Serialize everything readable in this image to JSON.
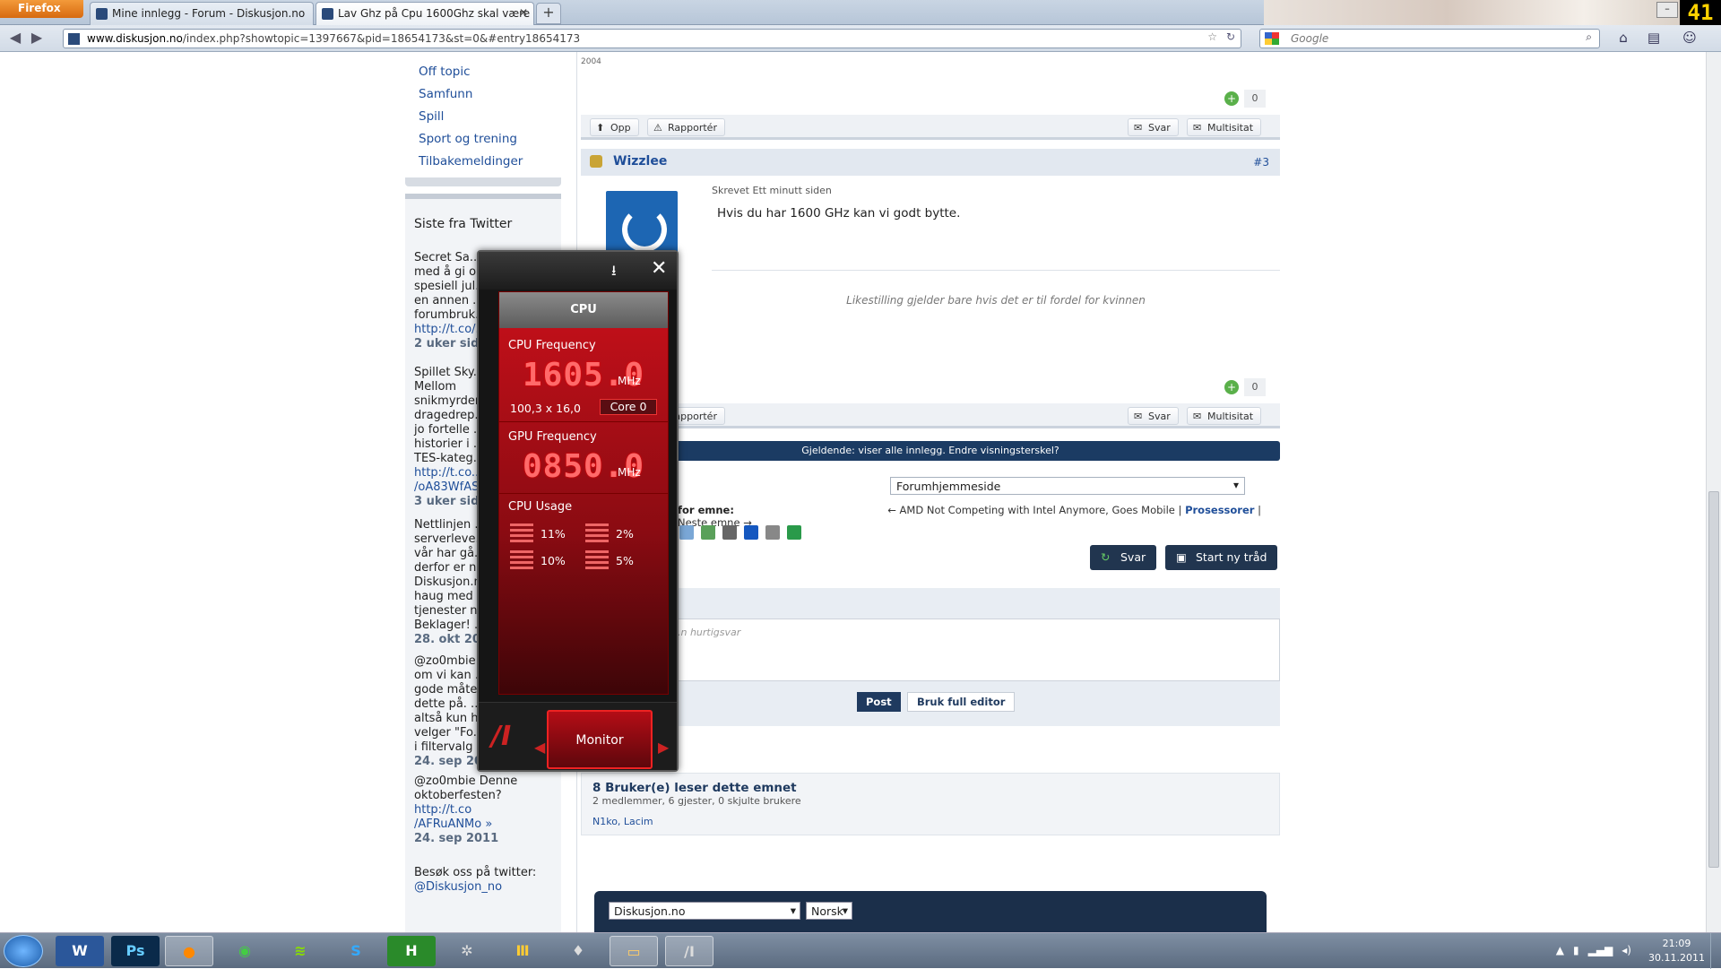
{
  "browser": {
    "firefox_label": "Firefox",
    "tabs": [
      {
        "title": "Mine innlegg - Forum - Diskusjon.no"
      },
      {
        "title": "Lav Ghz på Cpu 1600Ghz skal være 3,..."
      }
    ],
    "new_tab": "+",
    "url_host": "www.diskusjon.no",
    "url_path": "/index.php?showtopic=1397667&pid=18654173&st=0&#entry18654173",
    "search_placeholder": "Google",
    "clock_badge": "41"
  },
  "sidebar": {
    "categories": [
      "Off topic",
      "Samfunn",
      "Spill",
      "Sport og trening",
      "Tilbakemeldinger"
    ],
    "twitter_title": "Siste fra Twitter",
    "tweets": [
      {
        "lines": [
          "Secret Sa...",
          "med å gi o...",
          "spesiell jul...",
          "en annen ...",
          "forumbruk..."
        ],
        "link": "http://t.co/...",
        "date": "2 uker sid..."
      },
      {
        "lines": [
          "Spillet Sky...",
          "Mellom",
          "snikmyrder...",
          "dragedrep...",
          "jo fortelle ...",
          "historier i ...",
          "TES-kateg..."
        ],
        "link": "http://t.co...",
        "link2": "/oA83WfAS...",
        "date": "3 uker sid..."
      },
      {
        "lines": [
          "Nettlinjen ...",
          "serverleve...",
          "vår har gå...",
          "derfor er n...",
          "Diskusjon.n...",
          "haug med ...",
          "tjenester n...",
          "Beklager! ..."
        ],
        "date": "28. okt 20..."
      },
      {
        "lines": [
          "@zo0mbie ...",
          "om vi kan ...",
          "gode måte...",
          "dette på. ...",
          "altså kun h...",
          "velger \"Fo...",
          "i filtervalg \"s2k\"! »"
        ],
        "date": "24. sep 2011"
      },
      {
        "lines": [
          "@zo0mbie Denne",
          "oktoberfesten?"
        ],
        "link": "http://t.co",
        "link2": "/AFRuANMo »",
        "date": "24. sep 2011"
      }
    ],
    "footer_text": "Besøk oss på twitter:",
    "footer_handle": "@Diskusjon_no"
  },
  "post_prev": {
    "year_fragment": "2004",
    "rep_count": "0",
    "btn_up": "Opp",
    "btn_report": "Rapportér",
    "btn_reply": "Svar",
    "btn_multiquote": "Multisitat"
  },
  "post3": {
    "username": "Wizzlee",
    "post_num": "#3",
    "posted": "Skrevet Ett minutt siden",
    "body": "Hvis du har 1600 GHz kan vi godt bytte.",
    "signature": "Likestilling gjelder bare hvis det er til fordel for kvinnen",
    "rep_count": "0",
    "btn_report": "Rapportér",
    "btn_reply": "Svar",
    "btn_multiquote": "Multisitat"
  },
  "topic": {
    "visibility_bar": "Gjeldende: viser alle innlegg. Endre visningsterskel?",
    "jump_select": "Forumhjemmeside",
    "more_label": "for emne:",
    "prev_topic": "← AMD Not Competing with Intel Anymore, Goes Mobile",
    "forum": "Prosessorer",
    "next_topic": "Neste emne →",
    "reply_btn": "Svar",
    "new_thread_btn": "Start ny tråd",
    "quick_reply_placeholder": "...n hurtigsvar",
    "post_btn": "Post",
    "full_editor_btn": "Bruk full editor"
  },
  "readers": {
    "title": "8 Bruker(e) leser dette emnet",
    "summary": "2 medlemmer, 6 gjester, 0 skjulte brukere",
    "users": "N1ko, Lacim"
  },
  "footer": {
    "site_select": "Diskusjon.no",
    "lang_select": "Norsk"
  },
  "widget": {
    "header": "CPU",
    "cpu_freq_label": "CPU Frequency",
    "cpu_freq_value": "1605.0",
    "cpu_freq_unit": "MHz",
    "ratio": "100,3 x 16,0",
    "core": "Core 0",
    "gpu_freq_label": "GPU Frequency",
    "gpu_freq_value": "0850.0",
    "gpu_freq_unit": "MHz",
    "usage_label": "CPU Usage",
    "usage": [
      "11%",
      "2%",
      "10%",
      "5%"
    ],
    "monitor_btn": "Monitor"
  },
  "taskbar": {
    "clock_time": "21:09",
    "clock_date": "30.11.2011"
  }
}
